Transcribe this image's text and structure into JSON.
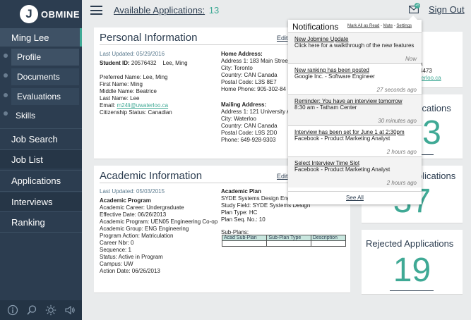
{
  "app": {
    "logo_letter": "J",
    "logo_text": "OBMINE"
  },
  "user": {
    "name": "Ming Lee"
  },
  "sidebar": {
    "subitems": [
      {
        "label": "Profile"
      },
      {
        "label": "Documents"
      },
      {
        "label": "Evaluations"
      },
      {
        "label": "Skills"
      }
    ],
    "items": [
      {
        "label": "Job Search"
      },
      {
        "label": "Job List"
      },
      {
        "label": "Applications"
      },
      {
        "label": "Interviews"
      },
      {
        "label": "Ranking"
      }
    ],
    "footer_icons": [
      "info-icon",
      "search-icon",
      "brightness-icon",
      "volume-icon"
    ]
  },
  "topbar": {
    "available_label": "Available Applications:",
    "available_count": "13",
    "notification_badge": "+5",
    "sign_out": "Sign Out"
  },
  "personal": {
    "title": "Personal Information",
    "edit": "Edit",
    "last_updated": "Last Updated: 05/29/2016",
    "student_id_label": "Student ID:",
    "student_id": "20576432",
    "student_name": "Lee, Ming",
    "preferred_name": "Preferred Name: Lee, Ming",
    "first_name": "First Name: Ming",
    "middle_name": "Middle Name: Beatrice",
    "last_name": "Last Name: Lee",
    "email_label": "Email:",
    "email": "m24li@uwaterloo.ca",
    "citizenship": "Citizenship Status: Canadian",
    "home_address_title": "Home Address:",
    "home_address": [
      "Address 1: 183 Main Stree",
      "City: Toronto",
      "Country: CAN Canada",
      "Postal Code: L3S 8E7",
      "Home Phone: 905-302-84"
    ],
    "mailing_address_title": "Mailing Address:",
    "mailing_address": [
      "Address 1: 121 University A",
      "City: Waterloo",
      "Country: CAN Canada",
      "Postal Code: L9S 2D0",
      "Phone: 649-928-9303"
    ]
  },
  "academic": {
    "title": "Academic Information",
    "edit": "Edit",
    "last_updated": "Last Updated: 05/03/2015",
    "program_title": "Academic Program",
    "program": [
      "Academic Career: Undergraduate",
      "Effective Date: 06/26/2013",
      "Academic Program: UEN05 Engineering Co-op",
      "Academic Group: ENG Engineering",
      "Program Action: Matriculation",
      "Career Nbr: 0",
      "Sequence: 1",
      "Status: Active in Program",
      "Campus: UW",
      "Action Date: 06/26/2013"
    ],
    "plan_title": "Academic Plan",
    "plan": [
      "SYDE Systems Design Engi",
      "Study Field: SYDE Systems Design",
      "Plan Type: HC",
      "Plan Seq. No.: 10"
    ],
    "subplans_title": "Sub-Plans:",
    "subplans_columns": [
      "Acad Sub-Plan",
      "Sub-Plan Type",
      "Description"
    ]
  },
  "right_cards": [
    {
      "title": "Pending Applications",
      "count": "3"
    },
    {
      "title": "Accepted Applications",
      "count": "37"
    },
    {
      "title": "Rejected Applications",
      "count": "19"
    }
  ],
  "contact_fragment": [
    "a",
    "4473",
    "terloo.ca"
  ],
  "notifications": {
    "title": "Notifications",
    "mark_all": "Mark All as Read",
    "mute": "Mute",
    "settings": "Settings",
    "items": [
      {
        "title": "New Jobmine Update",
        "desc": "Click here for a walkthrough of the new features",
        "time": "Now"
      },
      {
        "title": "New ranking has been posted",
        "desc": "Google Inc. - Software Engineer",
        "time": "27 seconds ago"
      },
      {
        "title": "Reminder: You have an interview tomorrow",
        "desc": "8:30 am - Tatham Center",
        "time": "30 minutes ago"
      },
      {
        "title": "Interview has been set for June 1 at 2:30pm",
        "desc": "Facebook - Product Marketing Analyst",
        "time": "2 hours ago"
      },
      {
        "title": "Select Interview Time Slot",
        "desc": "Facebook - Product Marketing Analyst",
        "time": "2 hours ago"
      }
    ],
    "see_all": "See All"
  }
}
